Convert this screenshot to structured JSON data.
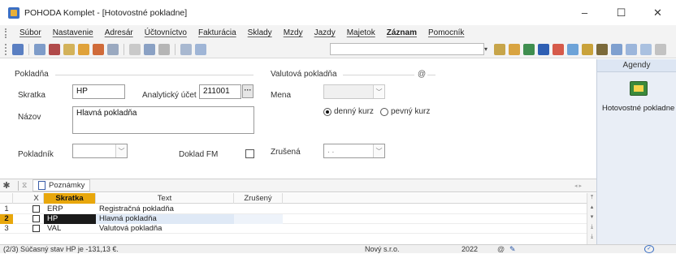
{
  "window": {
    "title": "POHODA Komplet - [Hotovostné pokladne]",
    "buttons": {
      "minimize": "–",
      "maximize": "☐",
      "close": "✕"
    }
  },
  "menu": [
    "Súbor",
    "Nastavenie",
    "Adresár",
    "Účtovníctvo",
    "Fakturácia",
    "Sklady",
    "Mzdy",
    "Jazdy",
    "Majetok",
    "Záznam",
    "Pomocník"
  ],
  "menu_bold_index": 9,
  "form": {
    "pokladna_group": "Pokladňa",
    "valutova_group": "Valutová pokladňa",
    "skratka_label": "Skratka",
    "skratka_value": "HP",
    "analyticky_ucet_label": "Analytický účet",
    "analyticky_ucet_value": "211001",
    "nazov_label": "Názov",
    "nazov_value": "Hlavná pokladňa",
    "pokladnik_label": "Pokladník",
    "pokladnik_value": "",
    "doklad_fm_label": "Doklad FM",
    "mena_label": "Mena",
    "mena_value": "",
    "denny_kurz_label": "denný kurz",
    "pevny_kurz_label": "pevný kurz",
    "zrusena_label": "Zrušená",
    "zrusena_value": ". ."
  },
  "agendy": {
    "header": "Agendy",
    "item_label": "Hotovostné pokladne"
  },
  "tabs": {
    "notes_label": "Poznámky"
  },
  "grid": {
    "columns": [
      "X",
      "Skratka",
      "Text",
      "Zrušený"
    ],
    "sorted_column": "Skratka",
    "rows": [
      {
        "num": "1",
        "code": "ERP",
        "text": "Registračná pokladňa",
        "zrusena": ""
      },
      {
        "num": "2",
        "code": "HP",
        "text": "Hlavná pokladňa",
        "zrusena": "",
        "active": true
      },
      {
        "num": "3",
        "code": "VAL",
        "text": "Valutová pokladňa",
        "zrusena": ""
      }
    ]
  },
  "status": {
    "message": "(2/3) Súčasný stav HP je -131,13 €.",
    "company": "Nový s.r.o.",
    "year": "2022"
  },
  "colors": {
    "accent_orange": "#e8a70c",
    "selected_row": "#1a1a1a",
    "agenda_bg": "#e9eef6"
  }
}
